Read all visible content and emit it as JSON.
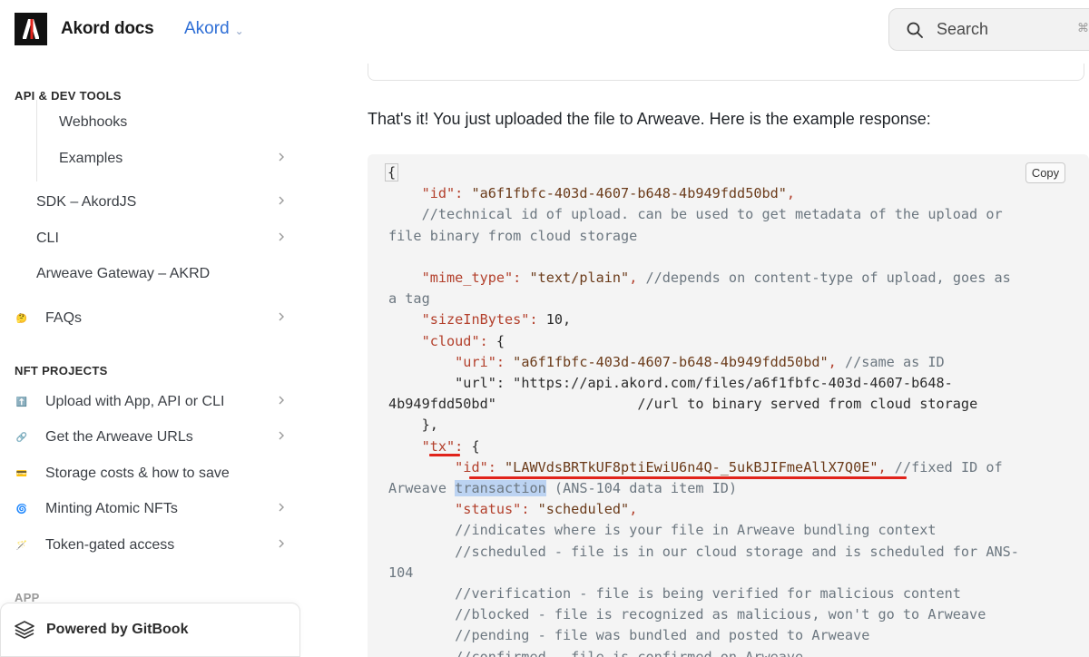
{
  "header": {
    "brand": "Akord docs",
    "space": "Akord",
    "search_placeholder": "Search",
    "search_shortcut": "⌘"
  },
  "sidebar": {
    "api_section": "API & DEV TOOLS",
    "api_items": [
      {
        "label": "Webhooks"
      },
      {
        "label": "Examples"
      },
      {
        "label": "SDK – AkordJS"
      },
      {
        "label": "CLI"
      },
      {
        "label": "Arweave Gateway – AKRD"
      },
      {
        "label": "FAQs",
        "icon": "🤔"
      }
    ],
    "nft_section": "NFT PROJECTS",
    "nft_items": [
      {
        "label": "Upload with App, API or CLI",
        "icon": "⬆️"
      },
      {
        "label": "Get the Arweave URLs",
        "icon": "🔗"
      },
      {
        "label": "Storage costs & how to save",
        "icon": "💳"
      },
      {
        "label": "Minting Atomic NFTs",
        "icon": "🌀"
      },
      {
        "label": "Token-gated access",
        "icon": "🪄"
      }
    ],
    "app_section": "APP",
    "powered_by": "Powered by GitBook"
  },
  "main": {
    "intro": "That's it! You just uploaded the file to Arweave. Here is the example response:",
    "copy_label": "Copy",
    "code": {
      "open": "{",
      "id_key": "\"id\"",
      "id_val": "\"a6f1fbfc-403d-4607-b648-4b949fdd50bd\"",
      "id_comment": "//technical id of upload. can be used to get metadata of the upload or",
      "id_comment2": "file binary from cloud storage",
      "mime_key": "\"mime_type\"",
      "mime_val": "\"text/plain\"",
      "mime_comment": "//depends on content-type of upload, goes as",
      "mime_comment2": "a tag",
      "size_key": "\"sizeInBytes\"",
      "size_val": "10",
      "cloud_key": "\"cloud\"",
      "uri_key": "\"uri\"",
      "uri_val": "\"a6f1fbfc-403d-4607-b648-4b949fdd50bd\"",
      "uri_comment": "//same as ID",
      "url_key": "\"url\"",
      "url_val": "\"https://api.akord.com/files/a6f1fbfc-403d-4607-b648-",
      "url_val2": "4b949fdd50bd\"",
      "url_comment": "//url to binary served from cloud storage",
      "tx_key": "\"tx\"",
      "tx_id_key": "\"id\"",
      "tx_id_val": "\"LAWVdsBRTkUF8ptiEwiU6n4Q-_5ukBJIFmeAllX7Q0E\"",
      "tx_id_comment": "//fixed ID of",
      "tx_id_comment2a": "Arweave",
      "tx_id_comment2b": "transaction",
      "tx_id_comment2c": "(ANS-104 data item ID)",
      "status_key": "\"status\"",
      "status_val": "\"scheduled\"",
      "c1": "//indicates where is your file in Arweave bundling context",
      "c2": "//scheduled - file is in our cloud storage and is scheduled for ANS-",
      "c2b": "104",
      "c3": "//verification - file is being verified for malicious content",
      "c4": "//blocked - file is recognized as malicious, won't go to Arweave",
      "c5": "//pending - file was bundled and posted to Arweave",
      "c6": "//confirmed - file is confirmed on Arweave"
    }
  }
}
